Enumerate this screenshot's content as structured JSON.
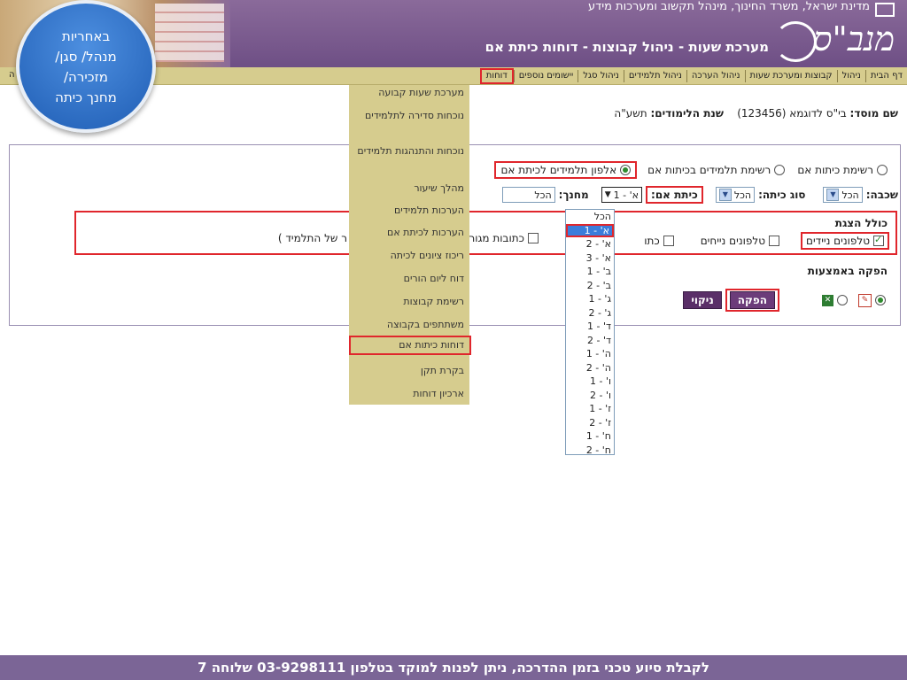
{
  "header": {
    "gov_text": "מדינת ישראל, משרד החינוך, מינהל תקשוב ומערכות מידע",
    "logo_text": "מנב\"ס",
    "system_title": "מערכת שעות - ניהול קבוצות - דוחות כיתת אם"
  },
  "menubar": {
    "items": [
      "דף הבית",
      "ניהול",
      "קבוצות ומערכת שעות",
      "ניהול הערכה",
      "ניהול תלמידים",
      "ניהול סגל",
      "יישומים נוספים",
      "דוחות"
    ],
    "trailing_fragment": "ה"
  },
  "callout": {
    "lines": [
      "באחריות",
      "מנהל/ סגן/",
      "מזכירה/",
      "מחנך כיתה"
    ]
  },
  "info": {
    "institution_label": "שם מוסד:",
    "institution_value": "בי\"ס לדוגמא (123456)",
    "year_label": "שנת הלימודים:",
    "year_value": "תשע\"ה"
  },
  "report_type": {
    "opt1": "רשימת כיתות אם",
    "opt2": "רשימת תלמידים בכיתות אם",
    "opt3": "אלפון תלמידים לכיתת אם"
  },
  "filters": {
    "grade_label": "שכבה:",
    "grade_value": "הכל",
    "class_type_label": "סוג כיתה:",
    "class_type_value": "הכל",
    "home_class_label": "כיתת אם:",
    "home_class_value": "א' - 1",
    "teacher_label": "מחנך:",
    "teacher_value": "הכל"
  },
  "display": {
    "title": "כולל הצגת",
    "mobile": "טלפונים ניידים",
    "landline": "טלפונים נייחים",
    "addr_fragment": "כתו",
    "residence_fragment": "כתובות מגור",
    "student_fragment": "ר של התלמיד )"
  },
  "output": {
    "title": "הפקה באמצעות",
    "produce": "הפקה",
    "clear": "ניקוי"
  },
  "reports_menu": {
    "items": [
      "מערכת שעות קבועה",
      "נוכחות סדירה לתלמידים",
      "נוכחות והתנהגות תלמידים",
      "מהלך שיעור",
      "הערכות תלמידים",
      "הערכות לכיתת אם",
      "ריכוז ציונים לכיתה",
      "דוח ליום הורים",
      "רשימת קבוצות",
      "משתתפים בקבוצה",
      "דוחות כיתות אם",
      "בקרת תקן",
      "ארכיון דוחות"
    ]
  },
  "class_list": {
    "options": [
      "הכל",
      "א' - 1",
      "א' - 2",
      "א' - 3",
      "ב' - 1",
      "ב' - 2",
      "ג' - 1",
      "ג' - 2",
      "ד' - 1",
      "ד' - 2",
      "ה' - 1",
      "ה' - 2",
      "ו' - 1",
      "ו' - 2",
      "ז' - 1",
      "ז' - 2",
      "ח' - 1",
      "ח' - 2"
    ]
  },
  "footer": {
    "text": "לקבלת סיוע טכני בזמן ההדרכה, ניתן לפנות למוקד בטלפון 03-9298111 שלוחה 7"
  }
}
